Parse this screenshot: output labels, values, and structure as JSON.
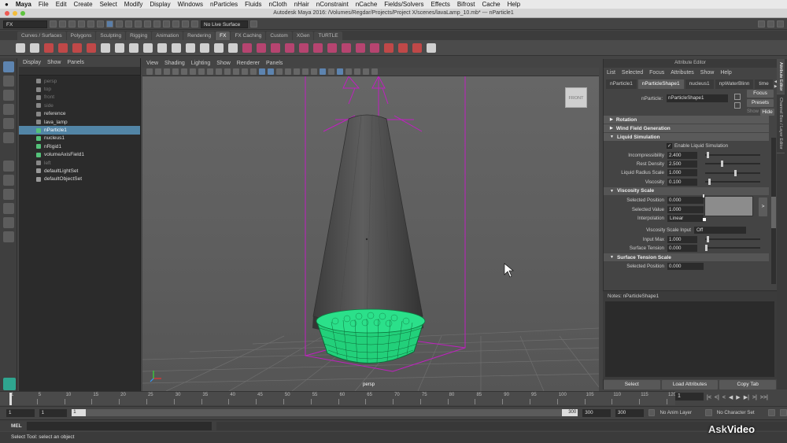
{
  "macbar": {
    "apple": "",
    "app": "Maya",
    "menus": [
      "File",
      "Edit",
      "Create",
      "Select",
      "Modify",
      "Display",
      "Windows",
      "nParticles",
      "Fluids",
      "nCloth",
      "nHair",
      "nConstraint",
      "nCache",
      "Fields/Solvers",
      "Effects",
      "Bifrost",
      "Cache",
      "Help"
    ]
  },
  "window": {
    "title": "Autodesk Maya 2016: /Volumes/Regdar/Projects/Project X/scenes/lavaLamp_10.mb*   ---   nParticle1"
  },
  "statusline": {
    "menuset": "FX",
    "live_surface": "No Live Surface"
  },
  "shelf": {
    "tabs": [
      "Curves / Surfaces",
      "Polygons",
      "Sculpting",
      "Rigging",
      "Animation",
      "Rendering",
      "FX",
      "FX Caching",
      "Custom",
      "XGen",
      "TURTLE"
    ],
    "active_tab": "FX"
  },
  "outliner": {
    "menu": [
      "Display",
      "Show",
      "Panels"
    ],
    "items": [
      {
        "label": "persp",
        "state": "dim"
      },
      {
        "label": "top",
        "state": "dim"
      },
      {
        "label": "front",
        "state": "dim"
      },
      {
        "label": "side",
        "state": "dim"
      },
      {
        "label": "reference",
        "state": "normal"
      },
      {
        "label": "lava_lamp",
        "state": "normal"
      },
      {
        "label": "nParticle1",
        "state": "selected"
      },
      {
        "label": "nucleus1",
        "state": "normal"
      },
      {
        "label": "nRigid1",
        "state": "normal"
      },
      {
        "label": "volumeAxisField1",
        "state": "normal"
      },
      {
        "label": "left",
        "state": "dim"
      },
      {
        "label": "defaultLightSet",
        "state": "normal"
      },
      {
        "label": "defaultObjectSet",
        "state": "normal"
      }
    ]
  },
  "viewport": {
    "menu": [
      "View",
      "Shading",
      "Lighting",
      "Show",
      "Renderer",
      "Panels"
    ],
    "camera_label": "persp",
    "viewcube_label": "FRONT"
  },
  "attribute_editor": {
    "title": "Attribute Editor",
    "menu": [
      "List",
      "Selected",
      "Focus",
      "Attributes",
      "Show",
      "Help"
    ],
    "tabs": [
      "nParticle1",
      "nParticleShape1",
      "nucleus1",
      "npWaterBlinn",
      "time"
    ],
    "active_tab": "nParticleShape1",
    "node_label": "nParticle:",
    "node_value": "nParticleShape1",
    "focus_button": "Focus",
    "presets_button": "Presets",
    "show_label": "Show",
    "hide_button": "Hide",
    "sections": {
      "rotation": "Rotation",
      "wind": "Wind Field Generation",
      "liquid": "Liquid Simulation",
      "viscosity_scale": "Viscosity Scale",
      "surface_tension_scale": "Surface Tension Scale"
    },
    "enable_liquid": {
      "label": "Enable Liquid Simulation",
      "checked": "✓"
    },
    "liquid_attrs": [
      {
        "label": "Incompressibility",
        "value": "2.400",
        "slider": 0.03
      },
      {
        "label": "Rest Density",
        "value": "2.500",
        "slider": 0.3
      },
      {
        "label": "Liquid Radius Scale",
        "value": "1.000",
        "slider": 0.55
      },
      {
        "label": "Viscosity",
        "value": "0.100",
        "slider": 0.06
      }
    ],
    "ramp_attrs": {
      "selected_position": {
        "label": "Selected Position",
        "value": "0.000"
      },
      "selected_value": {
        "label": "Selected Value",
        "value": "1.000"
      },
      "interpolation": {
        "label": "Interpolation",
        "value": "Linear"
      },
      "expand_icon": ">"
    },
    "viscosity_input": {
      "label": "Viscosity Scale Input",
      "value": "Off"
    },
    "input_max": {
      "label": "Input Max",
      "value": "1.000",
      "slider": 0.03
    },
    "surface_tension": {
      "label": "Surface Tension",
      "value": "0.000",
      "slider": 0.0
    },
    "surface_selected_position": {
      "label": "Selected Position",
      "value": "0.000"
    },
    "notes_label": "Notes:  nParticleShape1",
    "buttons": [
      "Select",
      "Load Attributes",
      "Copy Tab"
    ]
  },
  "side_tabs": [
    "Attribute Editor",
    "Channel Box / Layer Editor"
  ],
  "timeslider": {
    "ticks": [
      "1",
      "5",
      "10",
      "15",
      "20",
      "25",
      "30",
      "35",
      "40",
      "45",
      "50",
      "55",
      "60",
      "65",
      "70",
      "75",
      "80",
      "85",
      "90",
      "95",
      "100",
      "105",
      "110",
      "115",
      "120"
    ],
    "current_frame": "1",
    "playback_icons": [
      "|<",
      "<|",
      "<",
      "◀",
      "▶",
      "▶|",
      ">|",
      ">>|"
    ]
  },
  "range": {
    "start": "1",
    "inner_start": "1",
    "bar_in": "1",
    "bar_out": "300",
    "inner_end": "300",
    "end": "300",
    "anim_layer": "No Anim Layer",
    "char_set": "No Character Set"
  },
  "cmdline": {
    "lang": "MEL"
  },
  "help_line": "Select Tool: select an object",
  "watermark": {
    "a": "Ask",
    "b": "Video"
  }
}
